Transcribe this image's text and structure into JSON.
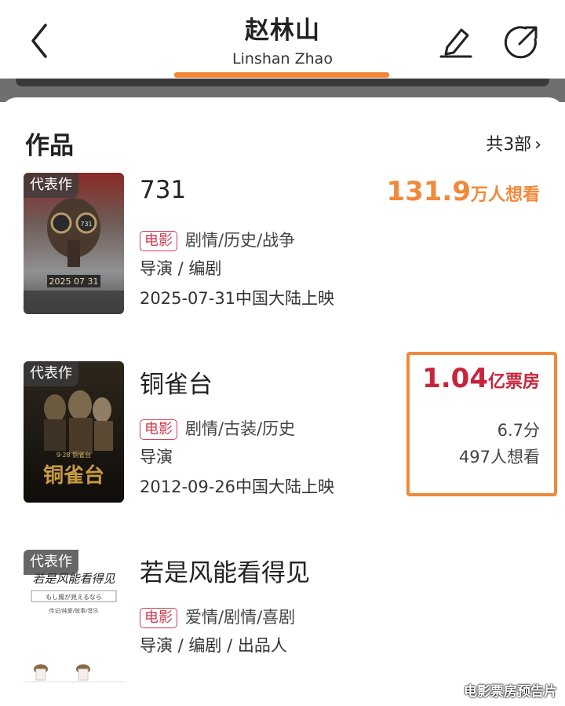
{
  "header": {
    "title_cn": "赵林山",
    "title_en": "Linshan Zhao"
  },
  "section": {
    "title": "作品",
    "count": "共3部",
    "chevron": "›"
  },
  "works": [
    {
      "tag": "代表作",
      "title": "731",
      "type_badge": "电影",
      "genres": "剧情/历史/战争",
      "roles": "导演 / 编剧",
      "release": "2025-07-31中国大陆上映",
      "want_value": "131.9",
      "want_unit": "万人想看"
    },
    {
      "tag": "代表作",
      "title": "铜雀台",
      "type_badge": "电影",
      "genres": "剧情/古装/历史",
      "roles": "导演",
      "release": "2012-09-26中国大陆上映",
      "box_value": "1.04",
      "box_unit": "亿票房",
      "score": "6.7分",
      "want": "497人想看"
    },
    {
      "tag": "代表作",
      "title": "若是风能看得见",
      "type_badge": "电影",
      "genres": "爱情/剧情/喜剧",
      "roles": "导演 / 编剧 / 出品人"
    }
  ],
  "poster1": {
    "date": "2025 07 31",
    "mark": "731"
  },
  "poster2": {
    "date_line": "9·28 铜雀台",
    "title": "铜雀台"
  },
  "poster3": {
    "title_line": "若是风能看得见",
    "jp_line": "もし風が見えるなら",
    "sub_line": "传记/纯爱/故事/音乐"
  },
  "watermark": "电影票房预告片",
  "colors": {
    "accent_orange": "#f0893a",
    "box_red": "#c8243c",
    "badge_red": "#d23a4e"
  },
  "icons": [
    "back-icon",
    "edit-icon",
    "share-icon",
    "chevron-right-icon"
  ]
}
